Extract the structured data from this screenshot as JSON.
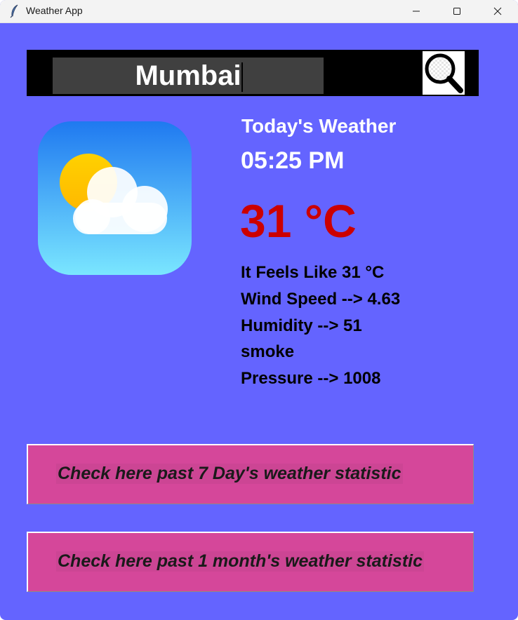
{
  "window": {
    "title": "Weather App",
    "icon": "feather-icon",
    "controls": [
      "minimize-icon",
      "maximize-icon",
      "close-icon"
    ]
  },
  "search": {
    "value": "Mumbai",
    "button_icon": "search-icon"
  },
  "current": {
    "icon": "partly-cloudy-icon",
    "heading": "Today's Weather",
    "time": "05:25 PM",
    "temperature": "31 °C",
    "feels_like": "It Feels Like 31 °C",
    "wind_speed": "Wind Speed --> 4.63",
    "humidity": "Humidity --> 51",
    "description": "smoke",
    "pressure": "Pressure --> 1008"
  },
  "buttons": {
    "week_label": "Check here past 7 Day's weather statistic",
    "month_label": "Check here past 1 month's weather statistic"
  },
  "colors": {
    "background": "#6464ff",
    "temperature": "#cc0000",
    "stat_button": "#d5479a",
    "search_bar": "#000000",
    "search_field": "#404040"
  }
}
